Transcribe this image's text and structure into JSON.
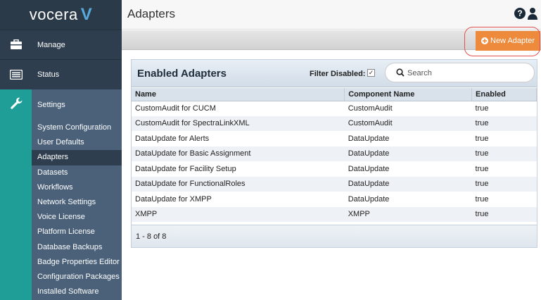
{
  "brand": {
    "logo_text": "vocera",
    "logo_mark": "V"
  },
  "nav": {
    "manage": "Manage",
    "status": "Status",
    "settings": "Settings"
  },
  "settings_items": [
    "System Configuration",
    "User Defaults",
    "Adapters",
    "Datasets",
    "Workflows",
    "Network Settings",
    "Voice License",
    "Platform License",
    "Database Backups",
    "Badge Properties Editor",
    "Configuration Packages",
    "Installed Software"
  ],
  "header": {
    "title": "Adapters",
    "help_icon": "?"
  },
  "toolbar": {
    "new_adapter": "New Adapter"
  },
  "panel": {
    "title": "Enabled Adapters",
    "filter_label": "Filter Disabled:",
    "filter_checked": "✓",
    "search_placeholder": "Search",
    "columns": [
      "Name",
      "Component Name",
      "Enabled"
    ],
    "rows": [
      [
        "CustomAudit for CUCM",
        "CustomAudit",
        "true"
      ],
      [
        "CustomAudit for SpectraLinkXML",
        "CustomAudit",
        "true"
      ],
      [
        "DataUpdate for Alerts",
        "DataUpdate",
        "true"
      ],
      [
        "DataUpdate for Basic Assignment",
        "DataUpdate",
        "true"
      ],
      [
        "DataUpdate for Facility Setup",
        "DataUpdate",
        "true"
      ],
      [
        "DataUpdate for FunctionalRoles",
        "DataUpdate",
        "true"
      ],
      [
        "DataUpdate for XMPP",
        "DataUpdate",
        "true"
      ],
      [
        "XMPP",
        "XMPP",
        "true"
      ]
    ],
    "pager": "1 - 8 of 8"
  },
  "colors": {
    "accent_orange": "#ee8a3c",
    "teal": "#1e9e96",
    "sidebar": "#2f3e4e",
    "settings_bg": "#4a6179"
  }
}
